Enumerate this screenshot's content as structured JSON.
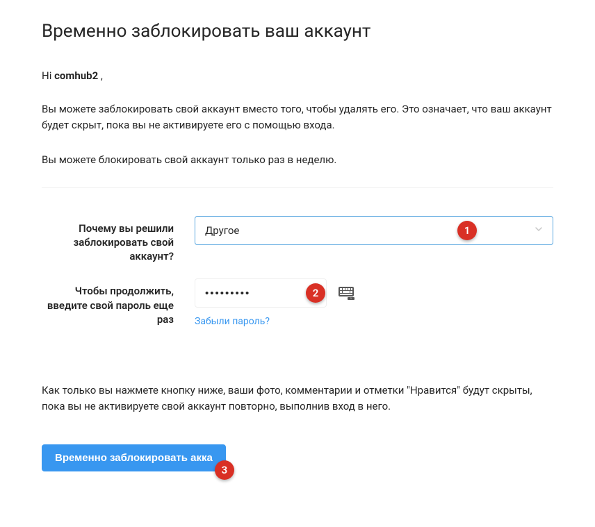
{
  "page": {
    "title": "Временно заблокировать ваш аккаунт"
  },
  "greeting": {
    "prefix": "Hi ",
    "username": "comhub2",
    "suffix": " ,"
  },
  "intro": {
    "p1": "Вы можете заблокировать свой аккаунт вместо того, чтобы удалять его. Это означает, что ваш аккаунт будет скрыт, пока вы не активируете его с помощью входа.",
    "p2": "Вы можете блокировать свой аккаунт только раз в неделю."
  },
  "form": {
    "reason_label": "Почему вы решили заблокировать свой аккаунт?",
    "reason_value": "Другое",
    "password_label": "Чтобы продолжить, введите свой пароль еще раз",
    "password_value": "•••••••••",
    "forgot_label": "Забыли пароль?"
  },
  "note": "Как только вы нажмете кнопку ниже, ваши фото, комментарии и отметки \"Нравится\" будут скрыты, пока вы не активируете свой аккаунт повторно, выполнив вход в него.",
  "submit_label": "Временно заблокировать акка",
  "markers": {
    "m1": "1",
    "m2": "2",
    "m3": "3"
  }
}
